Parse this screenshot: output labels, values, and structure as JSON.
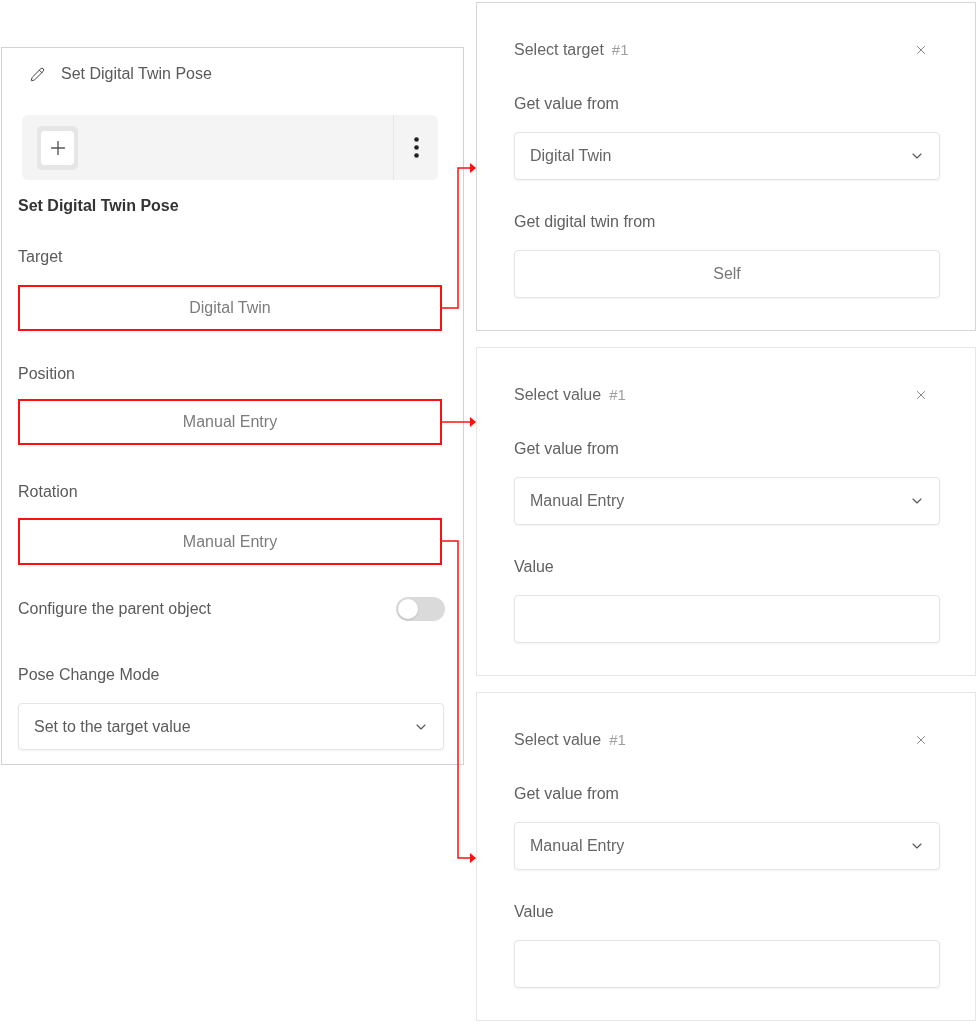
{
  "left_panel": {
    "header": {
      "title": "Set Digital Twin Pose"
    },
    "section_title": "Set Digital Twin Pose",
    "fields": [
      {
        "label": "Target",
        "value": "Digital Twin",
        "highlighted": true
      },
      {
        "label": "Position",
        "value": "Manual Entry",
        "highlighted": true
      },
      {
        "label": "Rotation",
        "value": "Manual Entry",
        "highlighted": true
      }
    ],
    "toggle": {
      "label": "Configure the parent object",
      "on": false
    },
    "pose_change_mode": {
      "label": "Pose Change Mode",
      "value": "Set to the target value"
    }
  },
  "detail_panels": [
    {
      "title": "Select target",
      "index": "#1",
      "rows": [
        {
          "kind": "select",
          "label": "Get value from",
          "value": "Digital Twin"
        },
        {
          "kind": "picker",
          "label": "Get digital twin from",
          "value": "Self"
        }
      ]
    },
    {
      "title": "Select value",
      "index": "#1",
      "rows": [
        {
          "kind": "select",
          "label": "Get value from",
          "value": "Manual Entry"
        },
        {
          "kind": "input",
          "label": "Value"
        }
      ]
    },
    {
      "title": "Select value",
      "index": "#1",
      "rows": [
        {
          "kind": "select",
          "label": "Get value from",
          "value": "Manual Entry"
        },
        {
          "kind": "input",
          "label": "Value"
        }
      ]
    }
  ]
}
